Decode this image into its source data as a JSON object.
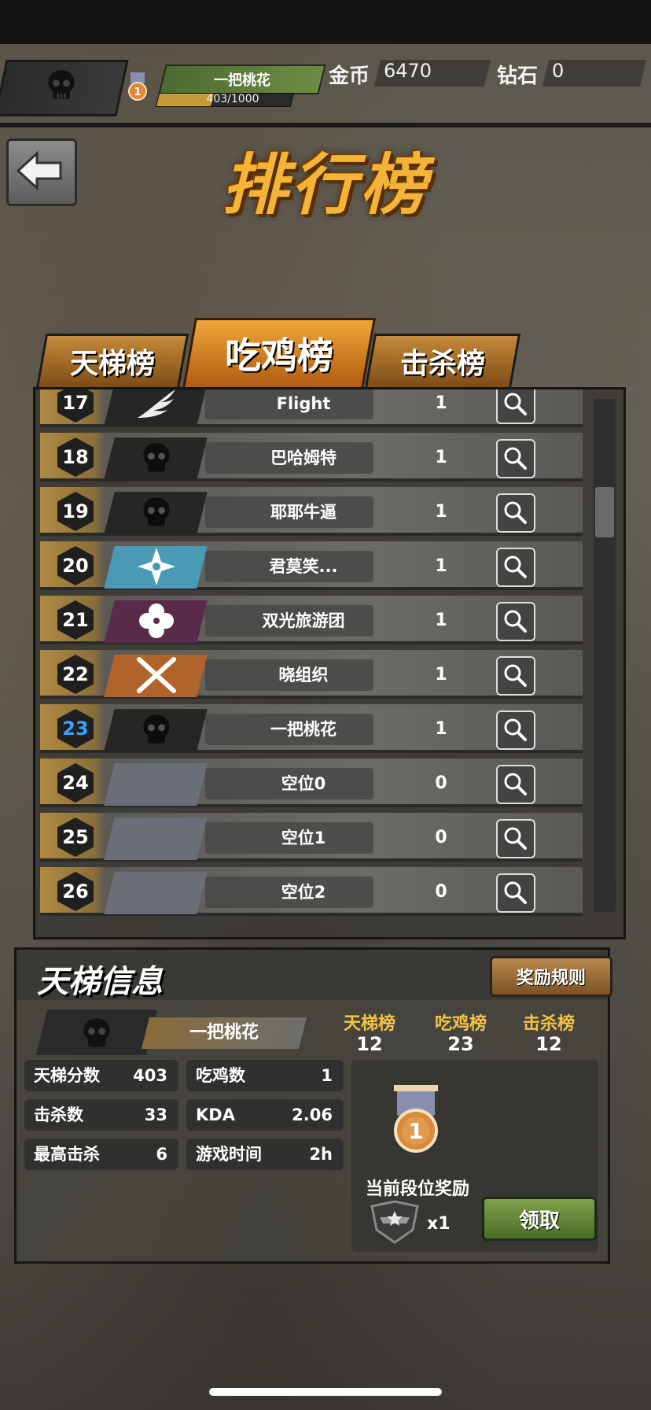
{
  "player": {
    "name": "一把桃花",
    "level_badge": "1",
    "exp_text": "403/1000",
    "exp_fraction": 0.403
  },
  "currency": {
    "gold_label": "金币",
    "gold_value": "6470",
    "diamond_label": "钻石",
    "diamond_value": "0"
  },
  "page": {
    "title": "排行榜"
  },
  "tabs": [
    {
      "label": "天梯榜"
    },
    {
      "label": "吃鸡榜"
    },
    {
      "label": "击杀榜"
    }
  ],
  "leaderboard": {
    "rows": [
      {
        "rank": "17",
        "name": "Flight",
        "score": "1",
        "icon": "wing-icon"
      },
      {
        "rank": "18",
        "name": "巴哈姆特",
        "score": "1",
        "icon": "skull-icon"
      },
      {
        "rank": "19",
        "name": "耶耶牛逼",
        "score": "1",
        "icon": "skull-icon"
      },
      {
        "rank": "20",
        "name": "君莫笑...",
        "score": "1",
        "icon": "shuriken-icon"
      },
      {
        "rank": "21",
        "name": "双光旅游团",
        "score": "1",
        "icon": "flower-icon"
      },
      {
        "rank": "22",
        "name": "晓组织",
        "score": "1",
        "icon": "crossed-blades-icon"
      },
      {
        "rank": "23",
        "name": "一把桃花",
        "score": "1",
        "icon": "skull-icon",
        "is_self": true
      },
      {
        "rank": "24",
        "name": "空位0",
        "score": "0",
        "icon": "empty"
      },
      {
        "rank": "25",
        "name": "空位1",
        "score": "0",
        "icon": "empty"
      },
      {
        "rank": "26",
        "name": "空位2",
        "score": "0",
        "icon": "empty"
      }
    ]
  },
  "info": {
    "title": "天梯信息",
    "rules_button": "奖励规则",
    "player_name": "一把桃花",
    "ranks": [
      {
        "label": "天梯榜",
        "value": "12"
      },
      {
        "label": "吃鸡榜",
        "value": "23"
      },
      {
        "label": "击杀榜",
        "value": "12"
      }
    ],
    "stats": {
      "ladder_score_label": "天梯分数",
      "ladder_score": "403",
      "kills_label": "击杀数",
      "kills": "33",
      "max_kills_label": "最高击杀",
      "max_kills": "6",
      "wins_label": "吃鸡数",
      "wins": "1",
      "kda_label": "KDA",
      "kda": "2.06",
      "playtime_label": "游戏时间",
      "playtime": "2h"
    },
    "reward": {
      "medal_number": "1",
      "label": "当前段位奖励",
      "qty": "x1",
      "claim_button": "领取"
    }
  },
  "colors": {
    "accent_gold": "#f3b437",
    "self_rank_blue": "#3aa2ff",
    "claim_green": "#6b8f3c"
  }
}
